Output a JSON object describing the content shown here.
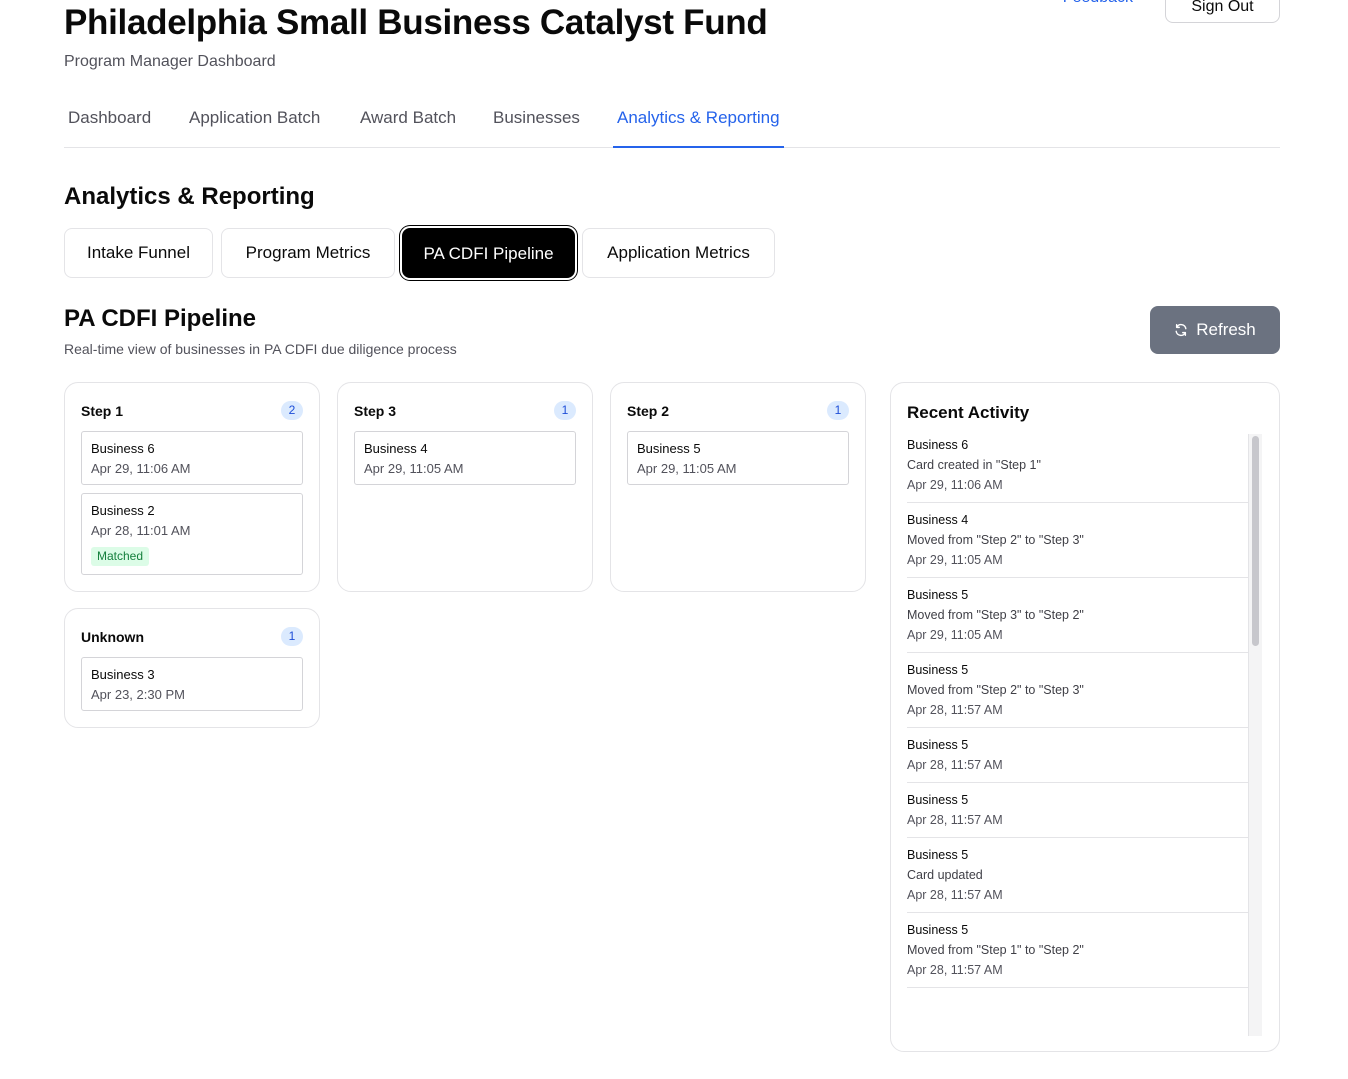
{
  "header": {
    "title": "Philadelphia Small Business Catalyst Fund",
    "subtitle": "Program Manager Dashboard",
    "feedback_label": "Feedback",
    "signout_label": "Sign Out"
  },
  "nav": {
    "tabs": [
      {
        "label": "Dashboard"
      },
      {
        "label": "Application Batch"
      },
      {
        "label": "Award Batch"
      },
      {
        "label": "Businesses"
      },
      {
        "label": "Analytics & Reporting"
      }
    ],
    "active": "Analytics & Reporting"
  },
  "section_title": "Analytics & Reporting",
  "sub_tabs": [
    {
      "label": "Intake Funnel"
    },
    {
      "label": "Program Metrics"
    },
    {
      "label": "PA CDFI Pipeline"
    },
    {
      "label": "Application Metrics"
    }
  ],
  "sub_tab_active": "PA CDFI Pipeline",
  "pipeline": {
    "title": "PA CDFI Pipeline",
    "description": "Real-time view of businesses in PA CDFI due diligence process",
    "refresh_label": "Refresh",
    "columns": [
      {
        "name": "Step 1",
        "count": "2",
        "cards": [
          {
            "name": "Business 6",
            "date": "Apr 29, 11:06 AM"
          },
          {
            "name": "Business 2",
            "date": "Apr 28, 11:01 AM",
            "badge": "Matched"
          }
        ]
      },
      {
        "name": "Step 3",
        "count": "1",
        "cards": [
          {
            "name": "Business 4",
            "date": "Apr 29, 11:05 AM"
          }
        ]
      },
      {
        "name": "Step 2",
        "count": "1",
        "cards": [
          {
            "name": "Business 5",
            "date": "Apr 29, 11:05 AM"
          }
        ]
      },
      {
        "name": "Unknown",
        "count": "1",
        "cards": [
          {
            "name": "Business 3",
            "date": "Apr 23, 2:30 PM"
          }
        ]
      }
    ]
  },
  "activity": {
    "title": "Recent Activity",
    "items": [
      {
        "name": "Business 6",
        "desc": "Card created in \"Step 1\"",
        "date": "Apr 29, 11:06 AM"
      },
      {
        "name": "Business 4",
        "desc": "Moved from \"Step 2\" to \"Step 3\"",
        "date": "Apr 29, 11:05 AM"
      },
      {
        "name": "Business 5",
        "desc": "Moved from \"Step 3\" to \"Step 2\"",
        "date": "Apr 29, 11:05 AM"
      },
      {
        "name": "Business 5",
        "desc": "Moved from \"Step 2\" to \"Step 3\"",
        "date": "Apr 28, 11:57 AM"
      },
      {
        "name": "Business 5",
        "desc": "",
        "date": "Apr 28, 11:57 AM"
      },
      {
        "name": "Business 5",
        "desc": "",
        "date": "Apr 28, 11:57 AM"
      },
      {
        "name": "Business 5",
        "desc": "Card updated",
        "date": "Apr 28, 11:57 AM"
      },
      {
        "name": "Business 5",
        "desc": "Moved from \"Step 1\" to \"Step 2\"",
        "date": "Apr 28, 11:57 AM"
      }
    ]
  },
  "colors": {
    "accent": "#2563eb",
    "badge_bg": "#dbeafe",
    "matched_bg": "#dcfce7",
    "matched_text": "#15803d",
    "refresh_bg": "#6b7280"
  }
}
